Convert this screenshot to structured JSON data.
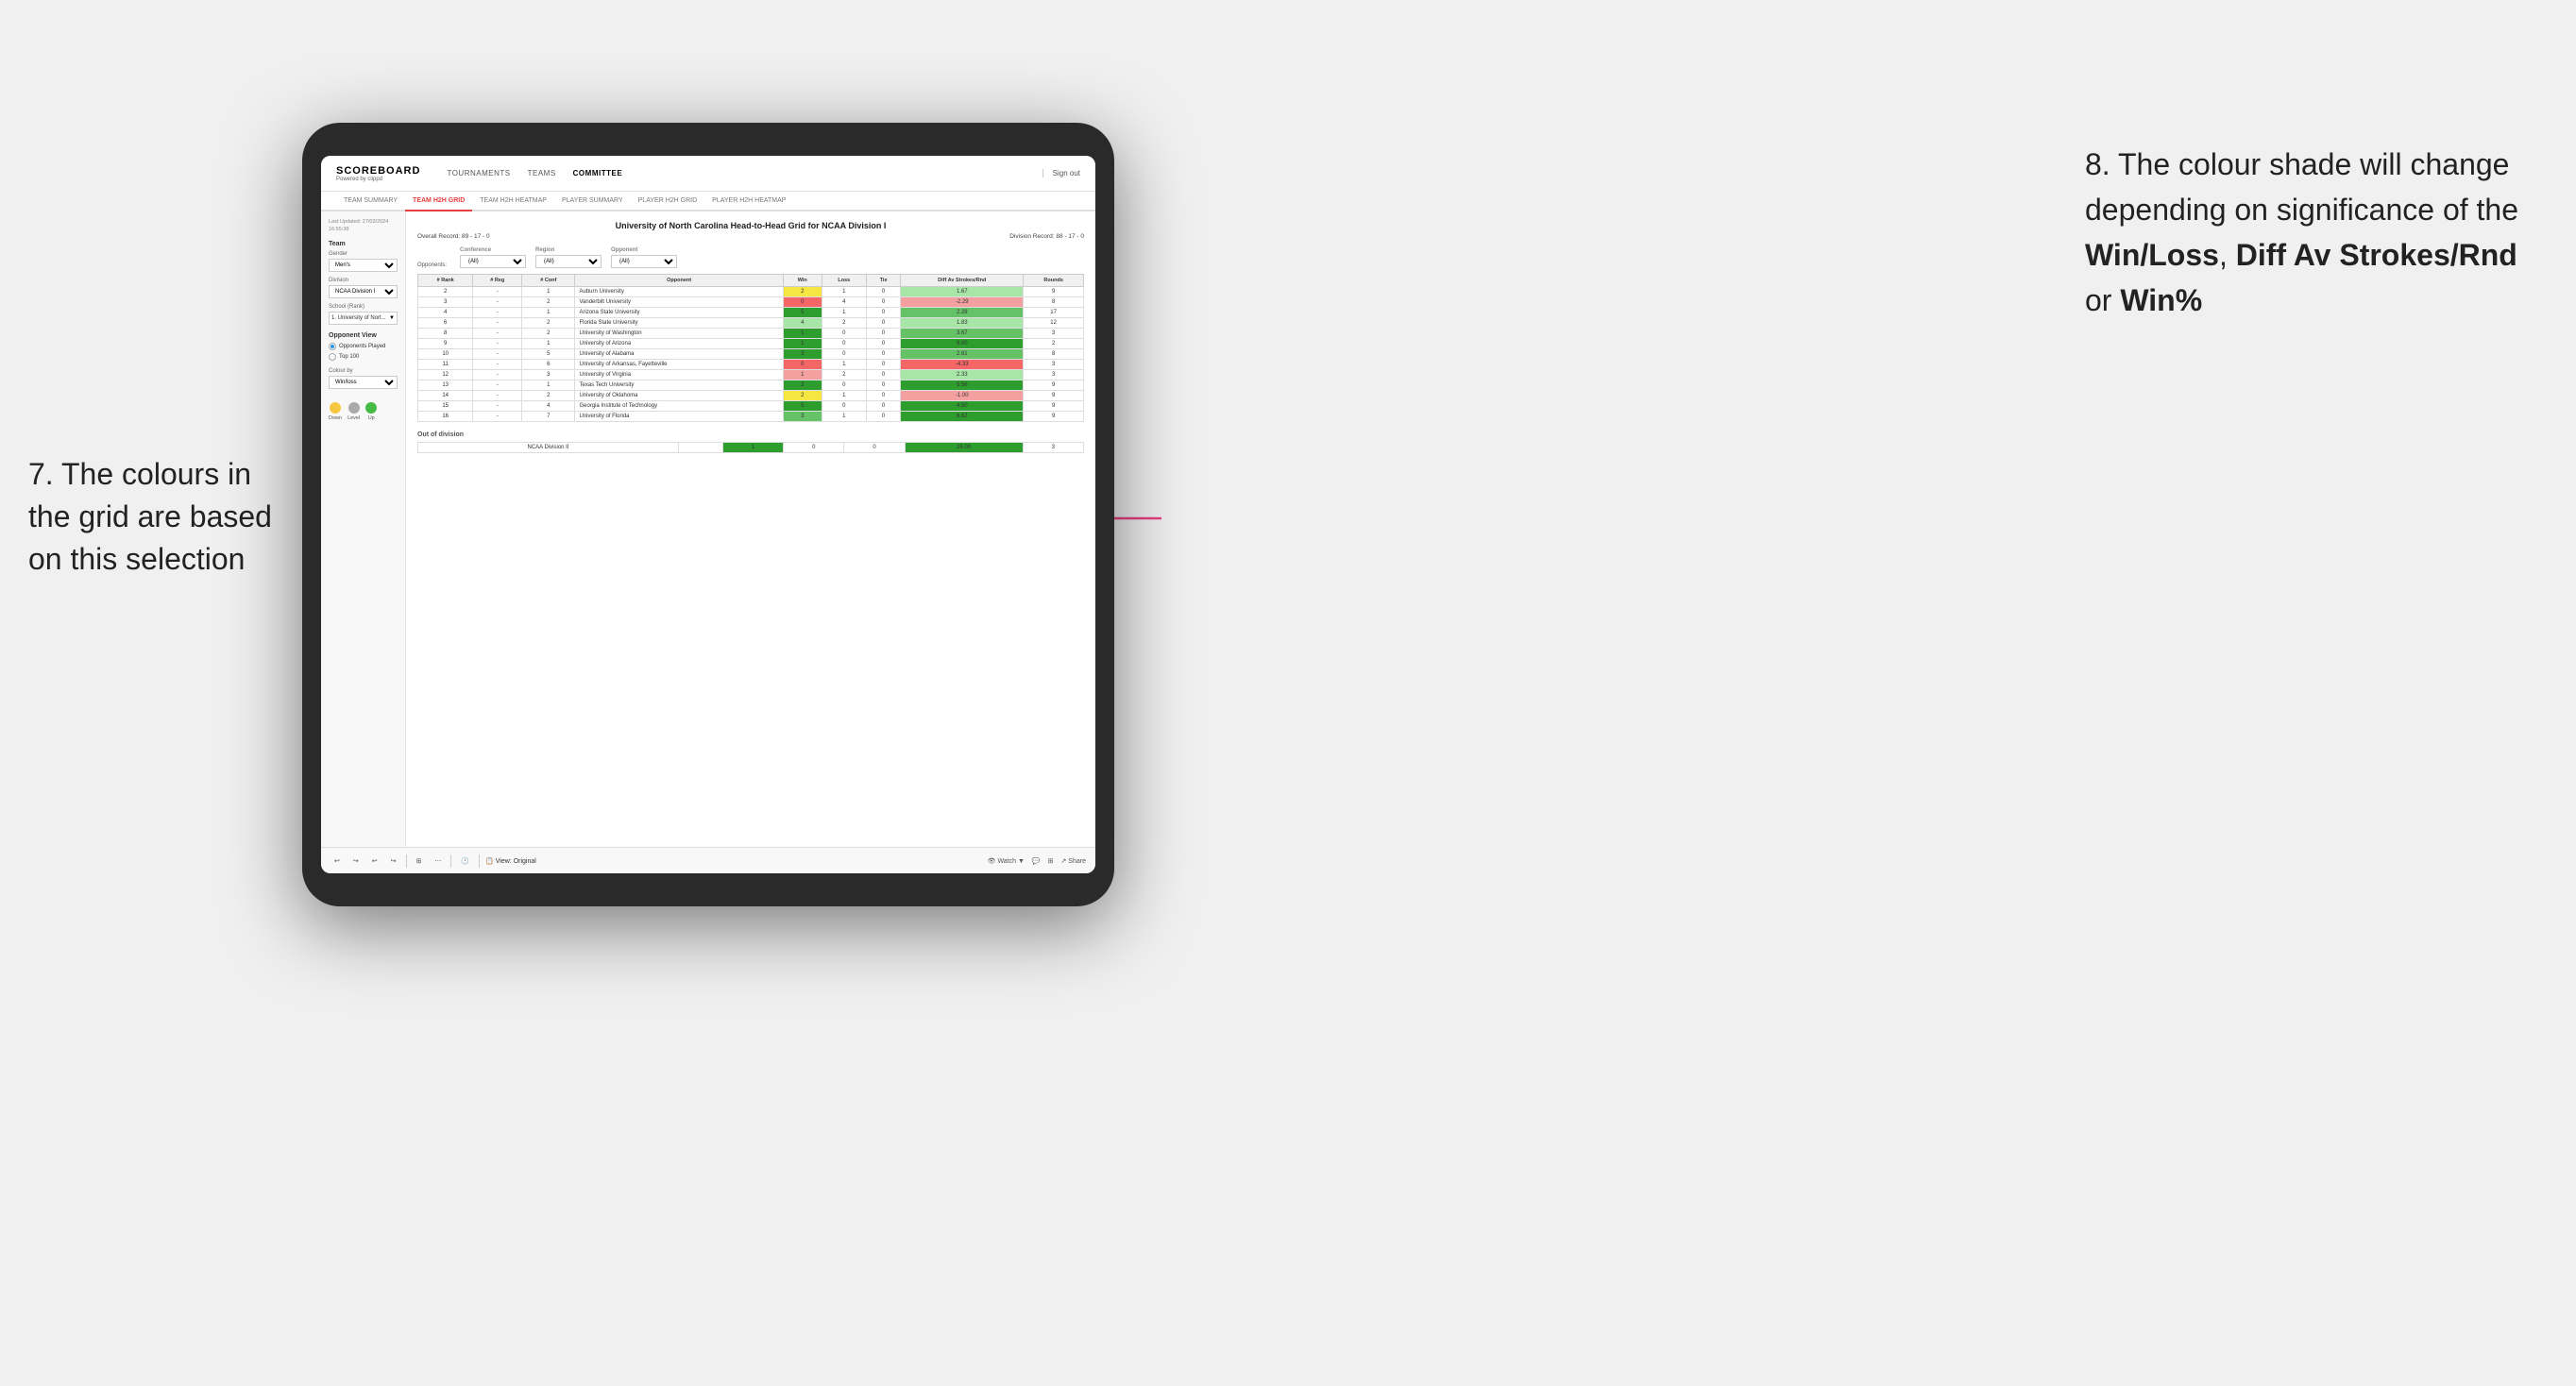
{
  "annotations": {
    "left_title": "7. The colours in the grid are based on this selection",
    "right_title": "8. The colour shade will change depending on significance of the",
    "right_bold1": "Win/Loss",
    "right_comma": ", ",
    "right_bold2": "Diff Av Strokes/Rnd",
    "right_or": " or",
    "right_bold3": "Win%"
  },
  "nav": {
    "logo": "SCOREBOARD",
    "logo_sub": "Powered by clippd",
    "items": [
      "TOURNAMENTS",
      "TEAMS",
      "COMMITTEE"
    ],
    "sign_out": "Sign out"
  },
  "sub_nav": {
    "items": [
      "TEAM SUMMARY",
      "TEAM H2H GRID",
      "TEAM H2H HEATMAP",
      "PLAYER SUMMARY",
      "PLAYER H2H GRID",
      "PLAYER H2H HEATMAP"
    ],
    "active": "TEAM H2H GRID"
  },
  "sidebar": {
    "last_updated_label": "Last Updated: 27/03/2024",
    "last_updated_time": "16:55:38",
    "team_label": "Team",
    "gender_label": "Gender",
    "gender_value": "Men's",
    "division_label": "Division",
    "division_value": "NCAA Division I",
    "school_label": "School (Rank)",
    "school_value": "1. University of Nort...",
    "opponent_view_label": "Opponent View",
    "radio1": "Opponents Played",
    "radio2": "Top 100",
    "colour_by_label": "Colour by",
    "colour_by_value": "Win/loss",
    "legend": {
      "down_label": "Down",
      "level_label": "Level",
      "up_label": "Up",
      "down_color": "#f5c842",
      "level_color": "#aaaaaa",
      "up_color": "#44bb44"
    }
  },
  "grid": {
    "title": "University of North Carolina Head-to-Head Grid for NCAA Division I",
    "overall_record": "Overall Record: 89 - 17 - 0",
    "division_record": "Division Record: 88 - 17 - 0",
    "filters": {
      "conference_label": "Conference",
      "conference_value": "(All)",
      "region_label": "Region",
      "region_value": "(All)",
      "opponent_label": "Opponent",
      "opponent_value": "(All)",
      "opponents_label": "Opponents:"
    },
    "columns": [
      "# Rank",
      "# Reg",
      "# Conf",
      "Opponent",
      "Win",
      "Loss",
      "Tie",
      "Diff Av Strokes/Rnd",
      "Rounds"
    ],
    "rows": [
      {
        "rank": "2",
        "reg": "-",
        "conf": "1",
        "opponent": "Auburn University",
        "win": "2",
        "loss": "1",
        "tie": "0",
        "diff": "1.67",
        "rounds": "9",
        "win_color": "yellow",
        "diff_color": "green_light"
      },
      {
        "rank": "3",
        "reg": "-",
        "conf": "2",
        "opponent": "Vanderbilt University",
        "win": "0",
        "loss": "4",
        "tie": "0",
        "diff": "-2.29",
        "rounds": "8",
        "win_color": "red_med",
        "diff_color": "red_light"
      },
      {
        "rank": "4",
        "reg": "-",
        "conf": "1",
        "opponent": "Arizona State University",
        "win": "5",
        "loss": "1",
        "tie": "0",
        "diff": "2.28",
        "rounds": "17",
        "win_color": "green_dark",
        "diff_color": "green_med"
      },
      {
        "rank": "6",
        "reg": "-",
        "conf": "2",
        "opponent": "Florida State University",
        "win": "4",
        "loss": "2",
        "tie": "0",
        "diff": "1.83",
        "rounds": "12",
        "win_color": "green_light",
        "diff_color": "green_light"
      },
      {
        "rank": "8",
        "reg": "-",
        "conf": "2",
        "opponent": "University of Washington",
        "win": "1",
        "loss": "0",
        "tie": "0",
        "diff": "3.67",
        "rounds": "3",
        "win_color": "green_dark",
        "diff_color": "green_med"
      },
      {
        "rank": "9",
        "reg": "-",
        "conf": "1",
        "opponent": "University of Arizona",
        "win": "1",
        "loss": "0",
        "tie": "0",
        "diff": "9.00",
        "rounds": "2",
        "win_color": "green_dark",
        "diff_color": "green_dark"
      },
      {
        "rank": "10",
        "reg": "-",
        "conf": "5",
        "opponent": "University of Alabama",
        "win": "3",
        "loss": "0",
        "tie": "0",
        "diff": "2.61",
        "rounds": "8",
        "win_color": "green_dark",
        "diff_color": "green_med"
      },
      {
        "rank": "11",
        "reg": "-",
        "conf": "6",
        "opponent": "University of Arkansas, Fayetteville",
        "win": "0",
        "loss": "1",
        "tie": "0",
        "diff": "-4.33",
        "rounds": "3",
        "win_color": "red_med",
        "diff_color": "red_med"
      },
      {
        "rank": "12",
        "reg": "-",
        "conf": "3",
        "opponent": "University of Virginia",
        "win": "1",
        "loss": "2",
        "tie": "0",
        "diff": "2.33",
        "rounds": "3",
        "win_color": "red_light",
        "diff_color": "green_light"
      },
      {
        "rank": "13",
        "reg": "-",
        "conf": "1",
        "opponent": "Texas Tech University",
        "win": "3",
        "loss": "0",
        "tie": "0",
        "diff": "5.56",
        "rounds": "9",
        "win_color": "green_dark",
        "diff_color": "green_dark"
      },
      {
        "rank": "14",
        "reg": "-",
        "conf": "2",
        "opponent": "University of Oklahoma",
        "win": "2",
        "loss": "1",
        "tie": "0",
        "diff": "-1.00",
        "rounds": "9",
        "win_color": "yellow",
        "diff_color": "red_light"
      },
      {
        "rank": "15",
        "reg": "-",
        "conf": "4",
        "opponent": "Georgia Institute of Technology",
        "win": "5",
        "loss": "0",
        "tie": "0",
        "diff": "4.50",
        "rounds": "9",
        "win_color": "green_dark",
        "diff_color": "green_dark"
      },
      {
        "rank": "16",
        "reg": "-",
        "conf": "7",
        "opponent": "University of Florida",
        "win": "3",
        "loss": "1",
        "tie": "0",
        "diff": "6.62",
        "rounds": "9",
        "win_color": "green_med",
        "diff_color": "green_dark"
      }
    ],
    "out_of_division": {
      "label": "Out of division",
      "row": {
        "division": "NCAA Division II",
        "win": "1",
        "loss": "0",
        "tie": "0",
        "diff": "26.00",
        "rounds": "3",
        "win_color": "green_dark",
        "diff_color": "green_dark"
      }
    }
  },
  "toolbar": {
    "view_label": "View: Original",
    "watch_label": "Watch",
    "share_label": "Share"
  }
}
